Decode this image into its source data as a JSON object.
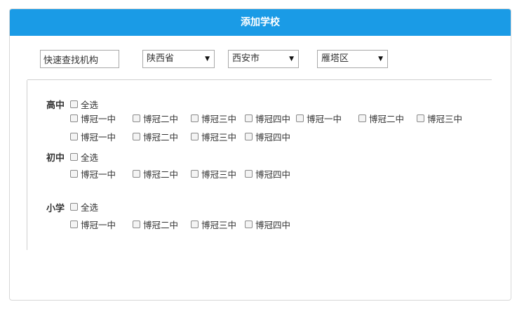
{
  "dialog": {
    "title": "添加学校"
  },
  "filters": {
    "search_value": "快速查找机构",
    "province": "陕西省",
    "city": "西安市",
    "district": "雁塔区"
  },
  "groups": {
    "high": {
      "label": "高中",
      "select_all": "全选",
      "schools": [
        "博冠一中",
        "博冠二中",
        "博冠三中",
        "博冠四中",
        "博冠一中",
        "博冠二中",
        "博冠三中",
        "博冠一中",
        "博冠二中",
        "博冠三中",
        "博冠四中"
      ]
    },
    "middle": {
      "label": "初中",
      "select_all": "全选",
      "schools": [
        "博冠一中",
        "博冠二中",
        "博冠三中",
        "博冠四中"
      ]
    },
    "primary": {
      "label": "小学",
      "select_all": "全选",
      "schools": [
        "博冠一中",
        "博冠二中",
        "博冠三中",
        "博冠四中"
      ]
    }
  }
}
